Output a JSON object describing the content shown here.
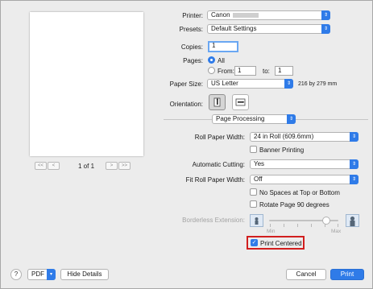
{
  "preview": {
    "page_indicator": "1 of 1",
    "nav": {
      "first": "<<",
      "prev": "<",
      "next": ">",
      "last": ">>"
    }
  },
  "printer": {
    "label": "Printer:",
    "value": "Canon"
  },
  "presets": {
    "label": "Presets:",
    "value": "Default Settings"
  },
  "copies": {
    "label": "Copies:",
    "value": "1"
  },
  "pages": {
    "label": "Pages:",
    "all_label": "All",
    "from_label": "From:",
    "from_value": "1",
    "to_label": "to:",
    "to_value": "1"
  },
  "paper_size": {
    "label": "Paper Size:",
    "value": "US Letter",
    "dimensions": "216 by 279 mm"
  },
  "orientation": {
    "label": "Orientation:"
  },
  "section": {
    "value": "Page Processing"
  },
  "roll_paper_width": {
    "label": "Roll Paper Width:",
    "value": "24 in Roll (609.6mm)"
  },
  "banner_printing": {
    "label": "Banner Printing",
    "checked": false
  },
  "automatic_cutting": {
    "label": "Automatic Cutting:",
    "value": "Yes"
  },
  "fit_roll_paper_width": {
    "label": "Fit Roll Paper Width:",
    "value": "Off"
  },
  "no_spaces": {
    "label": "No Spaces at Top or Bottom",
    "checked": false
  },
  "rotate_page": {
    "label": "Rotate Page 90 degrees",
    "checked": false
  },
  "borderless_extension": {
    "label": "Borderless Extension:",
    "min_label": "Min",
    "max_label": "Max",
    "level": 0.83
  },
  "print_centered": {
    "label": "Print Centered",
    "checked": true
  },
  "footer": {
    "help": "?",
    "pdf_label": "PDF",
    "hide_details_label": "Hide Details",
    "cancel_label": "Cancel",
    "print_label": "Print"
  },
  "colors": {
    "accent": "#2f7be8",
    "highlight": "#d11e1e",
    "background": "#ececec"
  }
}
